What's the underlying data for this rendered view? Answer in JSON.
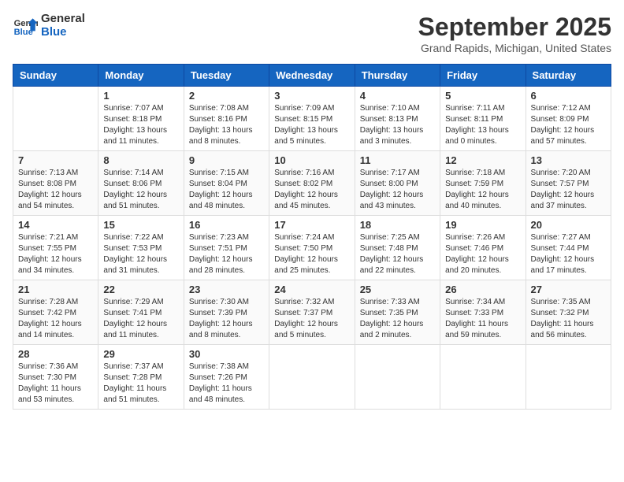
{
  "header": {
    "logo_line1": "General",
    "logo_line2": "Blue",
    "month": "September 2025",
    "location": "Grand Rapids, Michigan, United States"
  },
  "weekdays": [
    "Sunday",
    "Monday",
    "Tuesday",
    "Wednesday",
    "Thursday",
    "Friday",
    "Saturday"
  ],
  "weeks": [
    [
      {
        "day": "",
        "info": ""
      },
      {
        "day": "1",
        "info": "Sunrise: 7:07 AM\nSunset: 8:18 PM\nDaylight: 13 hours\nand 11 minutes."
      },
      {
        "day": "2",
        "info": "Sunrise: 7:08 AM\nSunset: 8:16 PM\nDaylight: 13 hours\nand 8 minutes."
      },
      {
        "day": "3",
        "info": "Sunrise: 7:09 AM\nSunset: 8:15 PM\nDaylight: 13 hours\nand 5 minutes."
      },
      {
        "day": "4",
        "info": "Sunrise: 7:10 AM\nSunset: 8:13 PM\nDaylight: 13 hours\nand 3 minutes."
      },
      {
        "day": "5",
        "info": "Sunrise: 7:11 AM\nSunset: 8:11 PM\nDaylight: 13 hours\nand 0 minutes."
      },
      {
        "day": "6",
        "info": "Sunrise: 7:12 AM\nSunset: 8:09 PM\nDaylight: 12 hours\nand 57 minutes."
      }
    ],
    [
      {
        "day": "7",
        "info": "Sunrise: 7:13 AM\nSunset: 8:08 PM\nDaylight: 12 hours\nand 54 minutes."
      },
      {
        "day": "8",
        "info": "Sunrise: 7:14 AM\nSunset: 8:06 PM\nDaylight: 12 hours\nand 51 minutes."
      },
      {
        "day": "9",
        "info": "Sunrise: 7:15 AM\nSunset: 8:04 PM\nDaylight: 12 hours\nand 48 minutes."
      },
      {
        "day": "10",
        "info": "Sunrise: 7:16 AM\nSunset: 8:02 PM\nDaylight: 12 hours\nand 45 minutes."
      },
      {
        "day": "11",
        "info": "Sunrise: 7:17 AM\nSunset: 8:00 PM\nDaylight: 12 hours\nand 43 minutes."
      },
      {
        "day": "12",
        "info": "Sunrise: 7:18 AM\nSunset: 7:59 PM\nDaylight: 12 hours\nand 40 minutes."
      },
      {
        "day": "13",
        "info": "Sunrise: 7:20 AM\nSunset: 7:57 PM\nDaylight: 12 hours\nand 37 minutes."
      }
    ],
    [
      {
        "day": "14",
        "info": "Sunrise: 7:21 AM\nSunset: 7:55 PM\nDaylight: 12 hours\nand 34 minutes."
      },
      {
        "day": "15",
        "info": "Sunrise: 7:22 AM\nSunset: 7:53 PM\nDaylight: 12 hours\nand 31 minutes."
      },
      {
        "day": "16",
        "info": "Sunrise: 7:23 AM\nSunset: 7:51 PM\nDaylight: 12 hours\nand 28 minutes."
      },
      {
        "day": "17",
        "info": "Sunrise: 7:24 AM\nSunset: 7:50 PM\nDaylight: 12 hours\nand 25 minutes."
      },
      {
        "day": "18",
        "info": "Sunrise: 7:25 AM\nSunset: 7:48 PM\nDaylight: 12 hours\nand 22 minutes."
      },
      {
        "day": "19",
        "info": "Sunrise: 7:26 AM\nSunset: 7:46 PM\nDaylight: 12 hours\nand 20 minutes."
      },
      {
        "day": "20",
        "info": "Sunrise: 7:27 AM\nSunset: 7:44 PM\nDaylight: 12 hours\nand 17 minutes."
      }
    ],
    [
      {
        "day": "21",
        "info": "Sunrise: 7:28 AM\nSunset: 7:42 PM\nDaylight: 12 hours\nand 14 minutes."
      },
      {
        "day": "22",
        "info": "Sunrise: 7:29 AM\nSunset: 7:41 PM\nDaylight: 12 hours\nand 11 minutes."
      },
      {
        "day": "23",
        "info": "Sunrise: 7:30 AM\nSunset: 7:39 PM\nDaylight: 12 hours\nand 8 minutes."
      },
      {
        "day": "24",
        "info": "Sunrise: 7:32 AM\nSunset: 7:37 PM\nDaylight: 12 hours\nand 5 minutes."
      },
      {
        "day": "25",
        "info": "Sunrise: 7:33 AM\nSunset: 7:35 PM\nDaylight: 12 hours\nand 2 minutes."
      },
      {
        "day": "26",
        "info": "Sunrise: 7:34 AM\nSunset: 7:33 PM\nDaylight: 11 hours\nand 59 minutes."
      },
      {
        "day": "27",
        "info": "Sunrise: 7:35 AM\nSunset: 7:32 PM\nDaylight: 11 hours\nand 56 minutes."
      }
    ],
    [
      {
        "day": "28",
        "info": "Sunrise: 7:36 AM\nSunset: 7:30 PM\nDaylight: 11 hours\nand 53 minutes."
      },
      {
        "day": "29",
        "info": "Sunrise: 7:37 AM\nSunset: 7:28 PM\nDaylight: 11 hours\nand 51 minutes."
      },
      {
        "day": "30",
        "info": "Sunrise: 7:38 AM\nSunset: 7:26 PM\nDaylight: 11 hours\nand 48 minutes."
      },
      {
        "day": "",
        "info": ""
      },
      {
        "day": "",
        "info": ""
      },
      {
        "day": "",
        "info": ""
      },
      {
        "day": "",
        "info": ""
      }
    ]
  ]
}
